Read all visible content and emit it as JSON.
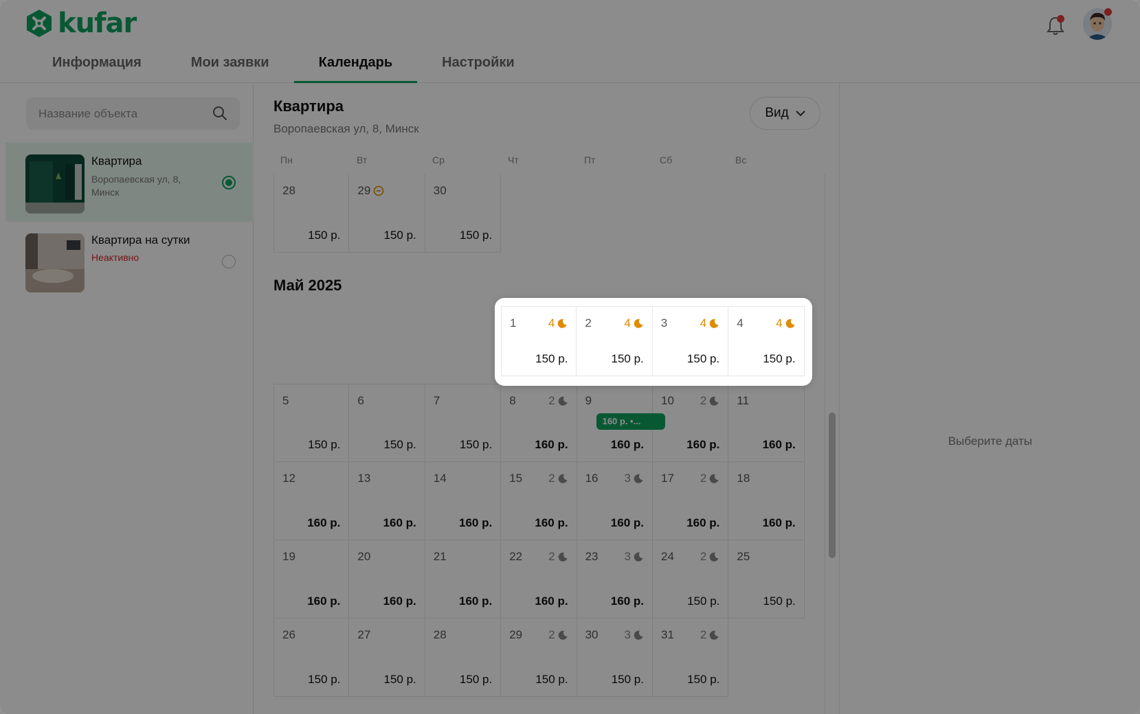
{
  "brand": {
    "name": "kufar",
    "color": "#10a060"
  },
  "tabs": [
    {
      "label": "Информация"
    },
    {
      "label": "Мои заявки"
    },
    {
      "label": "Календарь",
      "active": true
    },
    {
      "label": "Настройки"
    }
  ],
  "search": {
    "placeholder": "Название объекта"
  },
  "properties": [
    {
      "name": "Квартира",
      "address": "Воропаевская ул, 8, Минск",
      "selected": true
    },
    {
      "name": "Квартира на сутки",
      "status": "Неактивно",
      "selected": false
    }
  ],
  "object": {
    "title": "Квартира",
    "address": "Воропаевская ул, 8, Минск"
  },
  "view_button": "Вид",
  "weekdays": [
    "Пн",
    "Вт",
    "Ср",
    "Чт",
    "Пт",
    "Сб",
    "Вс"
  ],
  "april_tail": [
    {
      "day": "28",
      "price": "150 р."
    },
    {
      "day": "29",
      "price": "150 р.",
      "booked_icon": true
    },
    {
      "day": "30",
      "price": "150 р."
    }
  ],
  "month_title": "Май 2025",
  "may_highlight": [
    {
      "day": "1",
      "nights": "4",
      "price": "150 р."
    },
    {
      "day": "2",
      "nights": "4",
      "price": "150 р."
    },
    {
      "day": "3",
      "nights": "4",
      "price": "150 р."
    },
    {
      "day": "4",
      "nights": "4",
      "price": "150 р."
    }
  ],
  "may_weeks": [
    [
      {
        "day": "5",
        "price": "150 р."
      },
      {
        "day": "6",
        "price": "150 р."
      },
      {
        "day": "7",
        "price": "150 р."
      },
      {
        "day": "8",
        "nights": "2",
        "price": "160 р.",
        "bold": true
      },
      {
        "day": "9",
        "price": "160 р.",
        "bold": true,
        "badge": "160 р. •..."
      },
      {
        "day": "10",
        "nights": "2",
        "price": "160 р.",
        "bold": true
      },
      {
        "day": "11",
        "price": "160 р.",
        "bold": true
      }
    ],
    [
      {
        "day": "12",
        "price": "160 р.",
        "bold": true
      },
      {
        "day": "13",
        "price": "160 р.",
        "bold": true
      },
      {
        "day": "14",
        "price": "160 р.",
        "bold": true
      },
      {
        "day": "15",
        "nights": "2",
        "price": "160 р.",
        "bold": true
      },
      {
        "day": "16",
        "nights": "3",
        "price": "160 р.",
        "bold": true
      },
      {
        "day": "17",
        "nights": "2",
        "price": "160 р.",
        "bold": true
      },
      {
        "day": "18",
        "price": "160 р.",
        "bold": true
      }
    ],
    [
      {
        "day": "19",
        "price": "160 р.",
        "bold": true
      },
      {
        "day": "20",
        "price": "160 р.",
        "bold": true
      },
      {
        "day": "21",
        "price": "160 р.",
        "bold": true
      },
      {
        "day": "22",
        "nights": "2",
        "price": "160 р.",
        "bold": true
      },
      {
        "day": "23",
        "nights": "3",
        "price": "160 р.",
        "bold": true
      },
      {
        "day": "24",
        "nights": "2",
        "price": "150 р."
      },
      {
        "day": "25",
        "price": "150 р."
      }
    ],
    [
      {
        "day": "26",
        "price": "150 р."
      },
      {
        "day": "27",
        "price": "150 р."
      },
      {
        "day": "28",
        "price": "150 р."
      },
      {
        "day": "29",
        "nights": "2",
        "price": "150 р."
      },
      {
        "day": "30",
        "nights": "3",
        "price": "150 р."
      },
      {
        "day": "31",
        "nights": "2",
        "price": "150 р."
      }
    ]
  ],
  "right_panel": {
    "hint": "Выберите даты"
  },
  "colors": {
    "accent": "#10a060",
    "night_highlight": "#e08a00",
    "inactive": "#d6282f"
  }
}
